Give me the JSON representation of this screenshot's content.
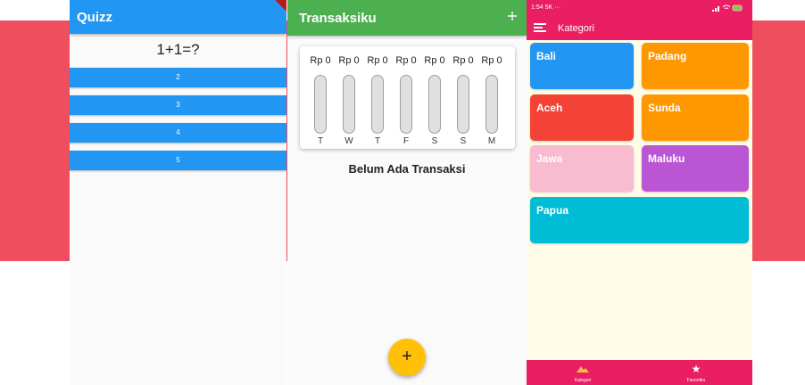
{
  "quiz": {
    "title": "Quizz",
    "question": "1+1=?",
    "answers": [
      "2",
      "3",
      "4",
      "5"
    ]
  },
  "transaksi": {
    "title": "Transaksiku",
    "add_icon": "plus-icon",
    "chart": {
      "amounts": [
        "Rp 0",
        "Rp 0",
        "Rp 0",
        "Rp 0",
        "Rp 0",
        "Rp 0",
        "Rp 0"
      ],
      "days": [
        "T",
        "W",
        "T",
        "F",
        "S",
        "S",
        "M"
      ],
      "fill_fractions": [
        0,
        0,
        0,
        0,
        0,
        0,
        0
      ]
    },
    "empty_message": "Belum Ada Transaksi",
    "fab_label": "+"
  },
  "kategori": {
    "status_time": "1:54",
    "status_time_suffix": "5K ···",
    "title": "Kategori",
    "menu_icon": "hamburger-menu-icon",
    "categories": [
      {
        "label": "Bali",
        "color": "#2196f3"
      },
      {
        "label": "Padang",
        "color": "#ff9800"
      },
      {
        "label": "Aceh",
        "color": "#f44336"
      },
      {
        "label": "Sunda",
        "color": "#ff9800"
      },
      {
        "label": "Jawa",
        "color": "#f8bbd0"
      },
      {
        "label": "Maluku",
        "color": "#ba55d3"
      },
      {
        "label": "Papua",
        "color": "#00bcd4"
      }
    ],
    "nav": [
      {
        "label": "Kategori",
        "icon": "mountain-icon"
      },
      {
        "label": "Favoritku",
        "icon": "star-icon"
      }
    ]
  },
  "colors": {
    "background_band": "#ee4e5e",
    "quiz_primary": "#2196f3",
    "transaksi_primary": "#4caf50",
    "fab": "#ffc107",
    "kategori_primary": "#e91e63",
    "kategori_background": "#fffde7"
  }
}
